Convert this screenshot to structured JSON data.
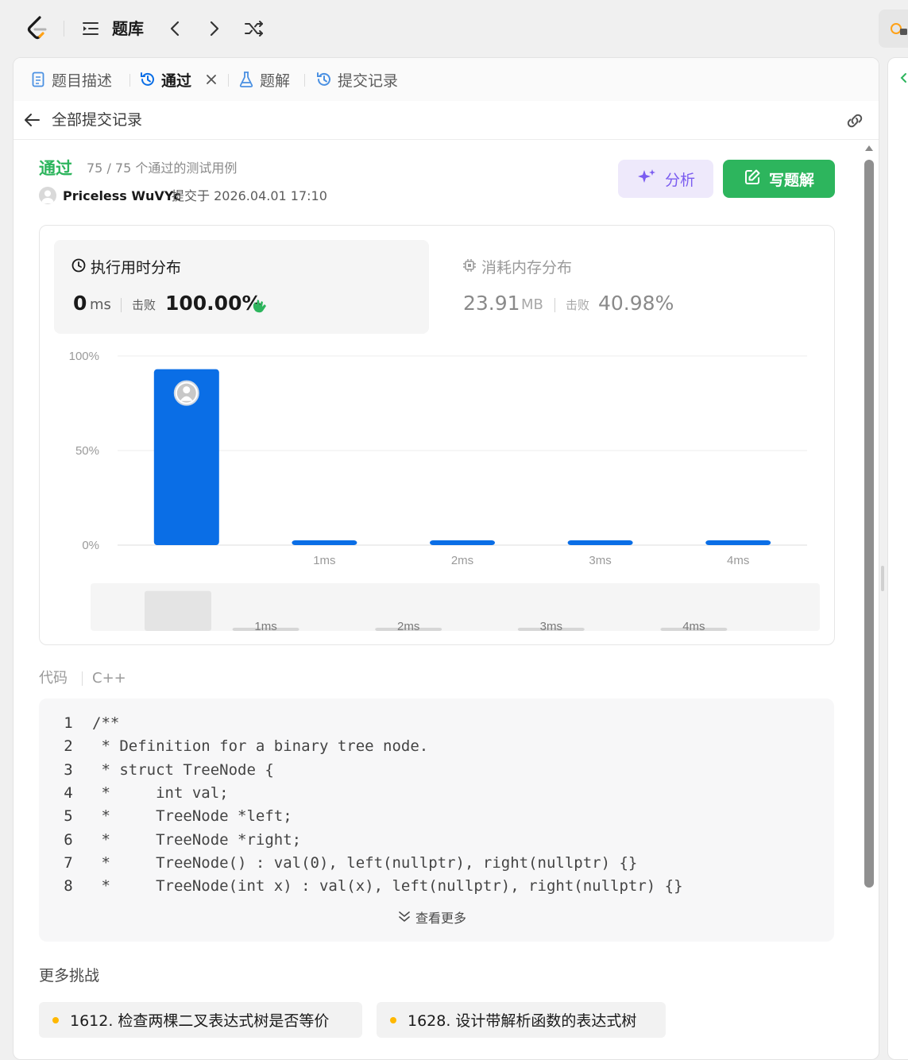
{
  "topbar": {
    "title": "题库"
  },
  "tabs": [
    {
      "label": "题目描述"
    },
    {
      "label": "通过"
    },
    {
      "label": "题解"
    },
    {
      "label": "提交记录"
    }
  ],
  "subheader": {
    "title": "全部提交记录"
  },
  "result": {
    "status": "通过",
    "count": "75 / 75 个通过的测试用例",
    "user": "Priceless WuVYc",
    "submitted": "提交于 2026.04.01 17:10"
  },
  "actions": {
    "analyze": "分析",
    "write": "写题解"
  },
  "runtime": {
    "title": "执行用时分布",
    "value": "0",
    "unit": "ms",
    "beat_label": "击败",
    "beat": "100.00%"
  },
  "memory": {
    "title": "消耗内存分布",
    "value": "23.91",
    "unit": "MB",
    "beat_label": "击败",
    "beat": "40.98%"
  },
  "chart_data": {
    "type": "bar",
    "categories": [
      "0ms",
      "1ms",
      "2ms",
      "3ms",
      "4ms"
    ],
    "tick_labels": [
      "",
      "1ms",
      "2ms",
      "3ms",
      "4ms"
    ],
    "values": [
      93,
      1,
      1,
      1,
      1
    ],
    "yticks": [
      "100%",
      "50%",
      "0%"
    ],
    "ylim": [
      0,
      100
    ],
    "highlight_index": 0,
    "bar_color": "#0a6ee6",
    "grid": true
  },
  "code": {
    "label": "代码",
    "lang": "C++",
    "lines": [
      "/**",
      " * Definition for a binary tree node.",
      " * struct TreeNode {",
      " *     int val;",
      " *     TreeNode *left;",
      " *     TreeNode *right;",
      " *     TreeNode() : val(0), left(nullptr), right(nullptr) {}",
      " *     TreeNode(int x) : val(x), left(nullptr), right(nullptr) {}"
    ],
    "show_more": "查看更多"
  },
  "more": {
    "title": "更多挑战",
    "items": [
      "1612. 检查两棵二叉表达式树是否等价",
      "1628. 设计带解析函数的表达式树"
    ]
  },
  "colors": {
    "green": "#2db55d",
    "blue": "#0a6ee6",
    "purple": "#7b5cf0",
    "orange": "#ffb800"
  }
}
